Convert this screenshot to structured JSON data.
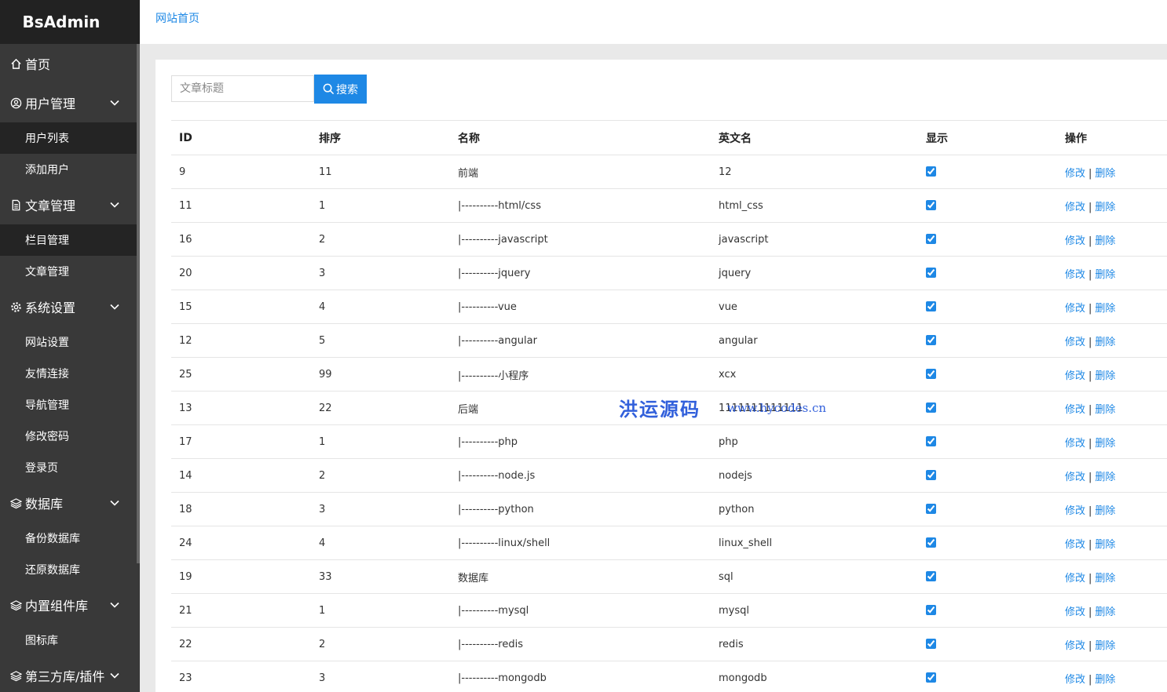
{
  "sidebar": {
    "brand": "BsAdmin",
    "menu": [
      {
        "type": "group",
        "icon": "home-icon",
        "label": "首页",
        "has_chevron": false
      },
      {
        "type": "group",
        "icon": "user-circle-icon",
        "label": "用户管理",
        "has_chevron": true
      },
      {
        "type": "sub",
        "label": "用户列表",
        "active": true
      },
      {
        "type": "sub",
        "label": "添加用户",
        "active": false
      },
      {
        "type": "group",
        "icon": "document-icon",
        "label": "文章管理",
        "has_chevron": true
      },
      {
        "type": "sub",
        "label": "栏目管理",
        "active": true
      },
      {
        "type": "sub",
        "label": "文章管理",
        "active": false
      },
      {
        "type": "group",
        "icon": "gear-icon",
        "label": "系统设置",
        "has_chevron": true
      },
      {
        "type": "sub",
        "label": "网站设置",
        "active": false
      },
      {
        "type": "sub",
        "label": "友情连接",
        "active": false
      },
      {
        "type": "sub",
        "label": "导航管理",
        "active": false
      },
      {
        "type": "sub",
        "label": "修改密码",
        "active": false
      },
      {
        "type": "sub",
        "label": "登录页",
        "active": false
      },
      {
        "type": "group",
        "icon": "layers-icon",
        "label": "数据库",
        "has_chevron": true
      },
      {
        "type": "sub",
        "label": "备份数据库",
        "active": false
      },
      {
        "type": "sub",
        "label": "还原数据库",
        "active": false
      },
      {
        "type": "group",
        "icon": "layers-icon",
        "label": "内置组件库",
        "has_chevron": true
      },
      {
        "type": "sub",
        "label": "图标库",
        "active": false
      },
      {
        "type": "group",
        "icon": "layers-icon",
        "label": "第三方库/插件",
        "has_chevron": true
      }
    ]
  },
  "topbar": {
    "breadcrumb": "网站首页"
  },
  "search": {
    "placeholder": "文章标题",
    "button_label": "搜索"
  },
  "table": {
    "headers": [
      "ID",
      "排序",
      "名称",
      "英文名",
      "显示",
      "操作"
    ],
    "edit_label": "修改",
    "delete_label": "删除",
    "separator": "|",
    "rows": [
      {
        "id": "9",
        "sort": "11",
        "name": "前端",
        "en": "12",
        "show": true
      },
      {
        "id": "11",
        "sort": "1",
        "name": "|----------html/css",
        "en": "html_css",
        "show": true
      },
      {
        "id": "16",
        "sort": "2",
        "name": "|----------javascript",
        "en": "javascript",
        "show": true
      },
      {
        "id": "20",
        "sort": "3",
        "name": "|----------jquery",
        "en": "jquery",
        "show": true
      },
      {
        "id": "15",
        "sort": "4",
        "name": "|----------vue",
        "en": "vue",
        "show": true
      },
      {
        "id": "12",
        "sort": "5",
        "name": "|----------angular",
        "en": "angular",
        "show": true
      },
      {
        "id": "25",
        "sort": "99",
        "name": "|----------小程序",
        "en": "xcx",
        "show": true
      },
      {
        "id": "13",
        "sort": "22",
        "name": "后端",
        "en": "1111111111111",
        "show": true
      },
      {
        "id": "17",
        "sort": "1",
        "name": "|----------php",
        "en": "php",
        "show": true
      },
      {
        "id": "14",
        "sort": "2",
        "name": "|----------node.js",
        "en": "nodejs",
        "show": true
      },
      {
        "id": "18",
        "sort": "3",
        "name": "|----------python",
        "en": "python",
        "show": true
      },
      {
        "id": "24",
        "sort": "4",
        "name": "|----------linux/shell",
        "en": "linux_shell",
        "show": true
      },
      {
        "id": "19",
        "sort": "33",
        "name": "数据库",
        "en": "sql",
        "show": true
      },
      {
        "id": "21",
        "sort": "1",
        "name": "|----------mysql",
        "en": "mysql",
        "show": true
      },
      {
        "id": "22",
        "sort": "2",
        "name": "|----------redis",
        "en": "redis",
        "show": true
      },
      {
        "id": "23",
        "sort": "3",
        "name": "|----------mongodb",
        "en": "mongodb",
        "show": true
      }
    ]
  },
  "watermark": {
    "text_cn": "洪运源码",
    "text_url": "www.hycodes.cn"
  }
}
